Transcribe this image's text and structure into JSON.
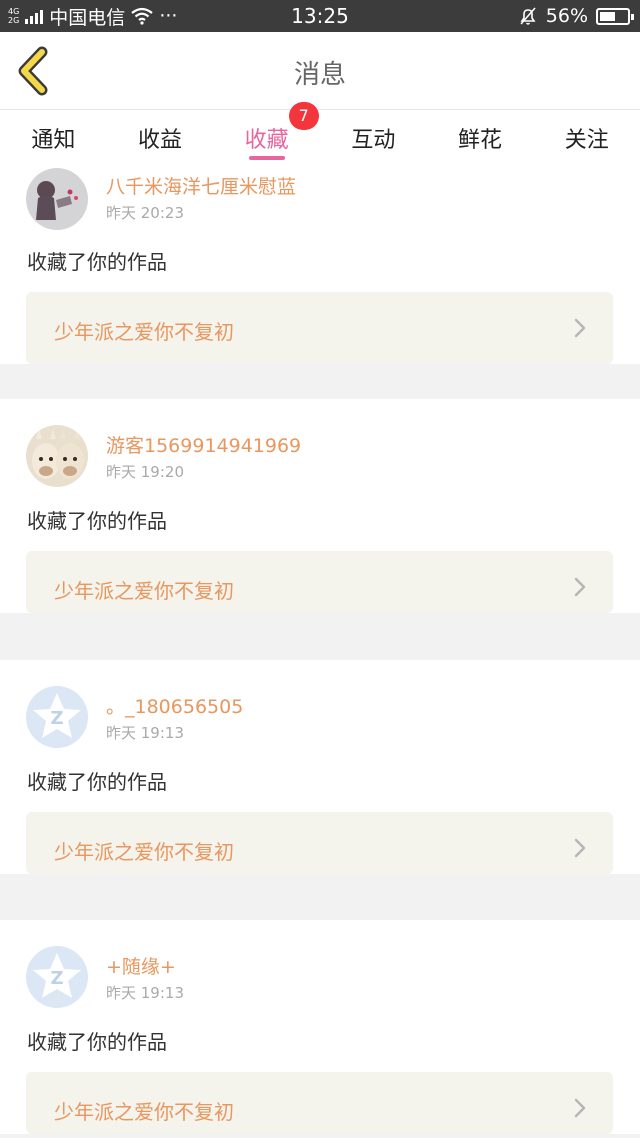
{
  "status_bar": {
    "network_top": "4G",
    "network_bottom": "2G",
    "carrier": "中国电信",
    "more": "···",
    "time": "13:25",
    "battery": "56%",
    "battery_level": 0.56
  },
  "header": {
    "title": "消息"
  },
  "tabs": [
    {
      "label": "通知",
      "active": false
    },
    {
      "label": "收益",
      "active": false
    },
    {
      "label": "收藏",
      "active": true,
      "badge": "7"
    },
    {
      "label": "互动",
      "active": false
    },
    {
      "label": "鲜花",
      "active": false
    },
    {
      "label": "关注",
      "active": false
    }
  ],
  "feed": [
    {
      "user": "八千米海洋七厘米慰蓝",
      "time": "昨天 20:23",
      "action": "收藏了你的作品",
      "work": "少年派之爱你不复初",
      "avatar": "photo-avatar-girl"
    },
    {
      "user": "游客1569914941969",
      "time": "昨天 19:20",
      "action": "收藏了你的作品",
      "work": "少年派之爱你不复初",
      "avatar": "alpaca-avatar"
    },
    {
      "user": "。_180656505",
      "time": "昨天 19:13",
      "action": "收藏了你的作品",
      "work": "少年派之爱你不复初",
      "avatar": "default-star-avatar"
    },
    {
      "user": "+随缘+",
      "time": "昨天 19:13",
      "action": "收藏了你的作品",
      "work": "少年派之爱你不复初",
      "avatar": "default-star-avatar"
    }
  ],
  "colors": {
    "accent": "#e8669e",
    "name": "#e8975f",
    "badge": "#f2363c",
    "back_icon": "#f5d84a"
  }
}
